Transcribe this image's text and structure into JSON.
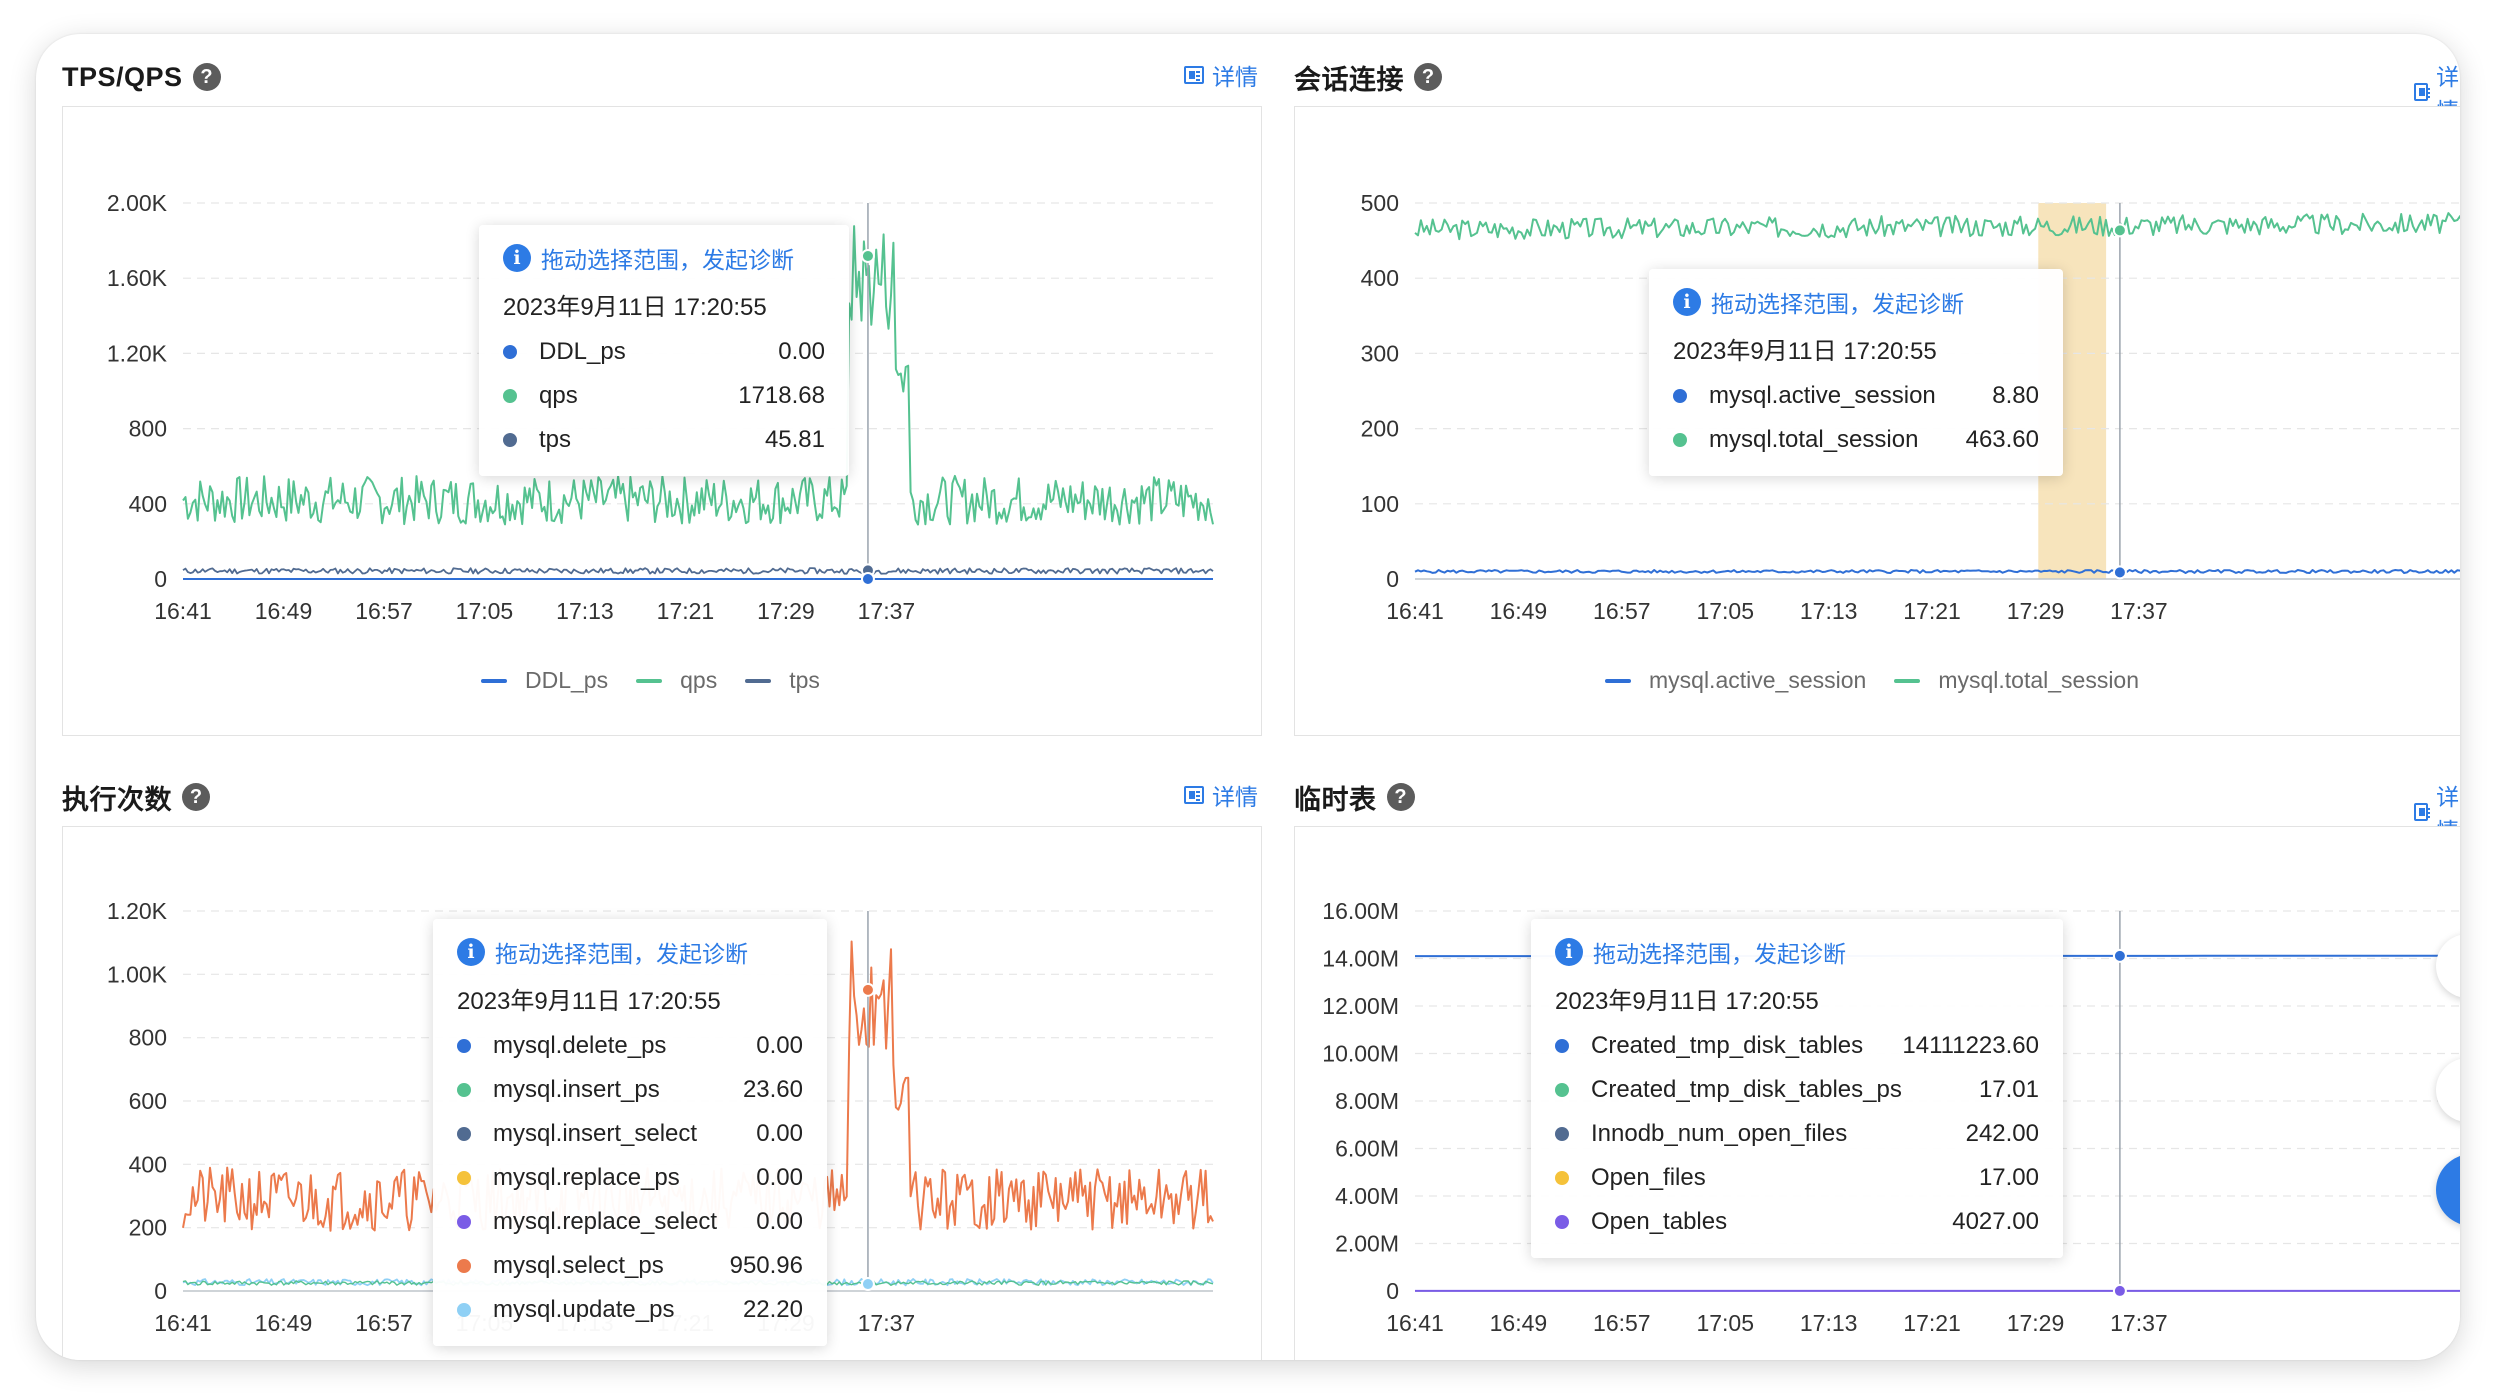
{
  "detail_label": "详情",
  "panels": [
    {
      "id": "tps_qps",
      "title": "TPS/QPS",
      "y_ticks": [
        "0",
        "400",
        "800",
        "1.20K",
        "1.60K",
        "2.00K"
      ],
      "x_ticks": [
        "16:41",
        "16:49",
        "16:57",
        "17:05",
        "17:13",
        "17:21",
        "17:29",
        "17:37"
      ],
      "legend": [
        {
          "name": "DDL_ps",
          "color": "#2f6fd6"
        },
        {
          "name": "qps",
          "color": "#55c290"
        },
        {
          "name": "tps",
          "color": "#516b91"
        }
      ],
      "tooltip": {
        "diagnose": "拖动选择范围，发起诊断",
        "time": "2023年9月11日 17:20:55",
        "rows": [
          {
            "name": "DDL_ps",
            "value": "0.00",
            "color": "#2f6fd6"
          },
          {
            "name": "qps",
            "value": "1718.68",
            "color": "#55c290"
          },
          {
            "name": "tps",
            "value": "45.81",
            "color": "#516b91"
          }
        ]
      }
    },
    {
      "id": "sessions",
      "title": "会话连接",
      "y_ticks": [
        "0",
        "100",
        "200",
        "300",
        "400",
        "500"
      ],
      "x_ticks": [
        "16:41",
        "16:49",
        "16:57",
        "17:05",
        "17:13",
        "17:21",
        "17:29",
        "17:37"
      ],
      "legend": [
        {
          "name": "mysql.active_session",
          "color": "#2f6fd6"
        },
        {
          "name": "mysql.total_session",
          "color": "#55c290"
        }
      ],
      "tooltip": {
        "diagnose": "拖动选择范围，发起诊断",
        "time": "2023年9月11日 17:20:55",
        "rows": [
          {
            "name": "mysql.active_session",
            "value": "8.80",
            "color": "#2f6fd6"
          },
          {
            "name": "mysql.total_session",
            "value": "463.60",
            "color": "#55c290"
          }
        ]
      }
    },
    {
      "id": "exec_count",
      "title": "执行次数",
      "y_ticks": [
        "0",
        "200",
        "400",
        "600",
        "800",
        "1.00K",
        "1.20K"
      ],
      "x_ticks": [
        "16:41",
        "16:49",
        "16:57",
        "17:05",
        "17:13",
        "17:21",
        "17:29",
        "17:37"
      ],
      "tooltip": {
        "diagnose": "拖动选择范围，发起诊断",
        "time": "2023年9月11日 17:20:55",
        "rows": [
          {
            "name": "mysql.delete_ps",
            "value": "0.00",
            "color": "#2f6fd6"
          },
          {
            "name": "mysql.insert_ps",
            "value": "23.60",
            "color": "#55c290"
          },
          {
            "name": "mysql.insert_select",
            "value": "0.00",
            "color": "#516b91"
          },
          {
            "name": "mysql.replace_ps",
            "value": "0.00",
            "color": "#f5c23a"
          },
          {
            "name": "mysql.replace_select",
            "value": "0.00",
            "color": "#7a5ce6"
          },
          {
            "name": "mysql.select_ps",
            "value": "950.96",
            "color": "#ec7a4c"
          },
          {
            "name": "mysql.update_ps",
            "value": "22.20",
            "color": "#8fd0f5"
          }
        ]
      }
    },
    {
      "id": "temp_tables",
      "title": "临时表",
      "y_ticks": [
        "0",
        "2.00M",
        "4.00M",
        "6.00M",
        "8.00M",
        "10.00M",
        "12.00M",
        "14.00M",
        "16.00M"
      ],
      "x_ticks": [
        "16:41",
        "16:49",
        "16:57",
        "17:05",
        "17:13",
        "17:21",
        "17:29",
        "17:37"
      ],
      "tooltip": {
        "diagnose": "拖动选择范围，发起诊断",
        "time": "2023年9月11日 17:20:55",
        "rows": [
          {
            "name": "Created_tmp_disk_tables",
            "value": "14111223.60",
            "color": "#2f6fd6"
          },
          {
            "name": "Created_tmp_disk_tables_ps",
            "value": "17.01",
            "color": "#55c290"
          },
          {
            "name": "Innodb_num_open_files",
            "value": "242.00",
            "color": "#516b91"
          },
          {
            "name": "Open_files",
            "value": "17.00",
            "color": "#f5c23a"
          },
          {
            "name": "Open_tables",
            "value": "4027.00",
            "color": "#7a5ce6"
          }
        ]
      }
    }
  ],
  "chart_data": [
    {
      "type": "line",
      "title": "TPS/QPS",
      "ylim": [
        0,
        2000
      ],
      "x": [
        "16:41",
        "16:49",
        "16:57",
        "17:05",
        "17:13",
        "17:21",
        "17:29",
        "17:37"
      ],
      "series": [
        {
          "name": "DDL_ps",
          "values": [
            0,
            0,
            0,
            0,
            0,
            0,
            0,
            0
          ]
        },
        {
          "name": "qps",
          "values": [
            380,
            440,
            420,
            380,
            410,
            1700,
            460,
            450
          ]
        },
        {
          "name": "tps",
          "values": [
            25,
            30,
            28,
            26,
            30,
            46,
            28,
            30
          ]
        }
      ]
    },
    {
      "type": "line",
      "title": "会话连接",
      "ylim": [
        0,
        500
      ],
      "x": [
        "16:41",
        "16:49",
        "16:57",
        "17:05",
        "17:13",
        "17:21",
        "17:29",
        "17:37"
      ],
      "series": [
        {
          "name": "mysql.active_session",
          "values": [
            8,
            9,
            8,
            9,
            9,
            8.8,
            9,
            9
          ]
        },
        {
          "name": "mysql.total_session",
          "values": [
            460,
            465,
            470,
            468,
            465,
            463.6,
            475,
            470
          ]
        }
      ]
    },
    {
      "type": "line",
      "title": "执行次数",
      "ylim": [
        0,
        1200
      ],
      "x": [
        "16:41",
        "16:49",
        "16:57",
        "17:05",
        "17:13",
        "17:21",
        "17:29",
        "17:37"
      ],
      "series": [
        {
          "name": "mysql.insert_ps",
          "values": [
            22,
            24,
            23,
            22,
            24,
            23.6,
            24,
            23
          ]
        },
        {
          "name": "mysql.select_ps",
          "values": [
            270,
            300,
            290,
            260,
            280,
            950,
            310,
            300
          ]
        },
        {
          "name": "mysql.update_ps",
          "values": [
            20,
            22,
            21,
            20,
            22,
            22.2,
            21,
            22
          ]
        }
      ]
    },
    {
      "type": "line",
      "title": "临时表",
      "ylim": [
        0,
        16000000
      ],
      "x": [
        "16:41",
        "16:49",
        "16:57",
        "17:05",
        "17:13",
        "17:21",
        "17:29",
        "17:37"
      ],
      "series": [
        {
          "name": "Created_tmp_disk_tables",
          "values": [
            14100000,
            14102000,
            14104000,
            14106000,
            14108000,
            14111223.6,
            14114000,
            14116000
          ]
        },
        {
          "name": "Open_tables",
          "values": [
            4027,
            4027,
            4027,
            4027,
            4027,
            4027,
            4027,
            4027
          ]
        }
      ]
    }
  ]
}
